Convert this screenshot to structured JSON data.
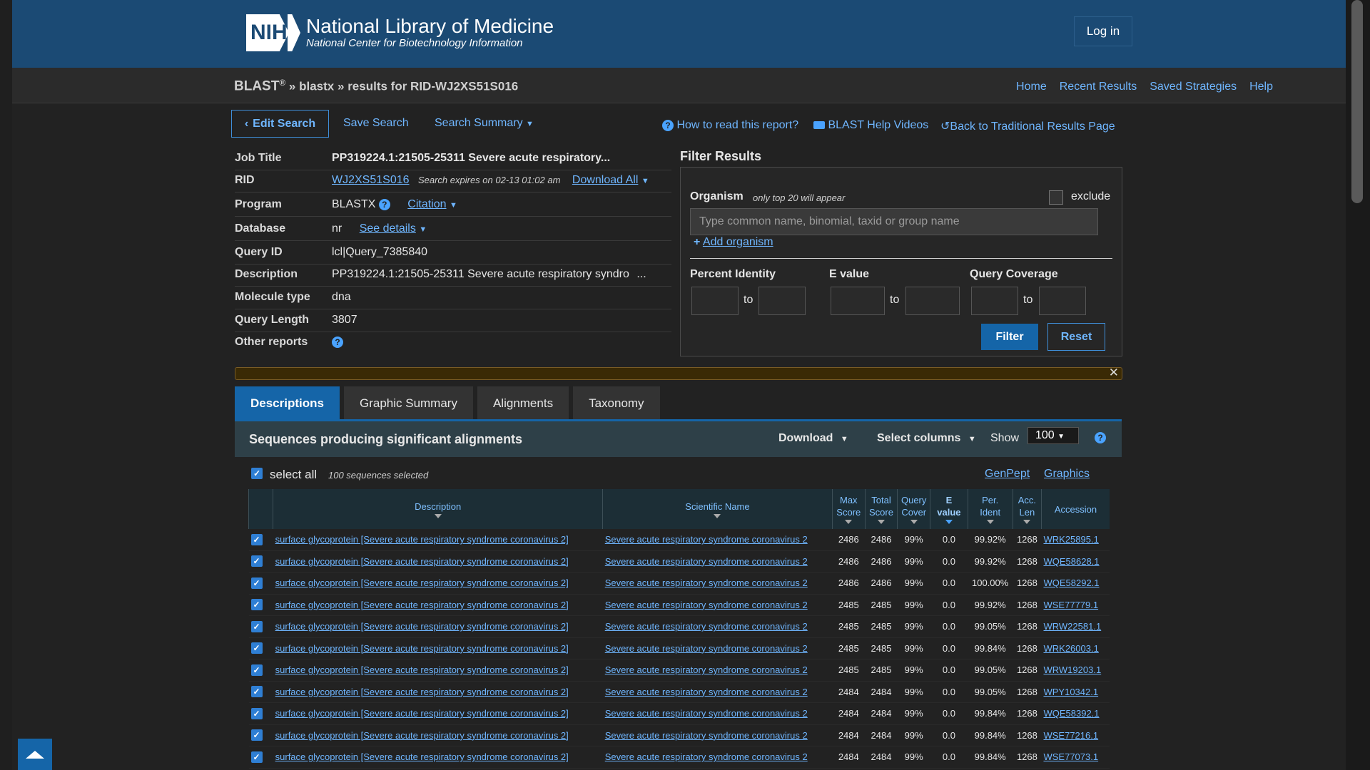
{
  "header": {
    "logo_short": "NIH",
    "org_name": "National Library of Medicine",
    "org_sub": "National Center for Biotechnology Information",
    "login_label": "Log in"
  },
  "breadcrumb": {
    "app": "BLAST",
    "reg": "®",
    "sep": "»",
    "program": "blastx",
    "results": "results for RID-WJ2XS51S016"
  },
  "subnav": [
    "Home",
    "Recent Results",
    "Saved Strategies",
    "Help"
  ],
  "toolbar": {
    "edit_search": "Edit Search",
    "save_search": "Save Search",
    "search_summary": "Search Summary",
    "how_to_read": "How to read this report?",
    "help_videos": "BLAST Help Videos",
    "back_traditional": "Back to Traditional Results Page"
  },
  "job": {
    "title_label": "Job Title",
    "title_value": "PP319224.1:21505-25311 Severe acute respiratory...",
    "rid_label": "RID",
    "rid_value": "WJ2XS51S016",
    "rid_expires": "Search expires on 02-13 01:02 am",
    "download_all": "Download All",
    "program_label": "Program",
    "program_value": "BLASTX",
    "citation": "Citation",
    "database_label": "Database",
    "database_value": "nr",
    "see_details": "See details",
    "query_id_label": "Query ID",
    "query_id_value": "lcl|Query_7385840",
    "description_label": "Description",
    "description_value": "PP319224.1:21505-25311 Severe acute respiratory syndro",
    "description_more": "...",
    "molecule_label": "Molecule type",
    "molecule_value": "dna",
    "query_length_label": "Query Length",
    "query_length_value": "3807",
    "other_reports_label": "Other reports"
  },
  "filter": {
    "title": "Filter Results",
    "organism_label": "Organism",
    "organism_note": "only top 20 will appear",
    "exclude_label": "exclude",
    "organism_placeholder": "Type common  name, binomial, taxid or group  name",
    "add_organism": "Add organism",
    "percent_identity": "Percent Identity",
    "e_value": "E value",
    "query_coverage": "Query Coverage",
    "to": "to",
    "filter_btn": "Filter",
    "reset_btn": "Reset"
  },
  "tabs": [
    "Descriptions",
    "Graphic Summary",
    "Alignments",
    "Taxonomy"
  ],
  "results": {
    "title": "Sequences producing significant alignments",
    "download": "Download",
    "select_columns": "Select columns",
    "show_label": "Show",
    "show_value": "100",
    "select_all": "select all",
    "selected_count": "100 sequences selected",
    "genpept": "GenPept",
    "graphics": "Graphics",
    "columns": {
      "description": "Description",
      "scientific_name": "Scientific Name",
      "max_score_1": "Max",
      "max_score_2": "Score",
      "total_score_1": "Total",
      "total_score_2": "Score",
      "query_cover_1": "Query",
      "query_cover_2": "Cover",
      "e_value_1": "E",
      "e_value_2": "value",
      "per_ident_1": "Per.",
      "per_ident_2": "Ident",
      "acc_len_1": "Acc.",
      "acc_len_2": "Len",
      "accession": "Accession"
    },
    "rows": [
      {
        "desc": "surface glycoprotein [Severe acute respiratory syndrome coronavirus 2]",
        "sci": "Severe acute respiratory syndrome coronavirus 2",
        "max": "2486",
        "total": "2486",
        "cover": "99%",
        "evalue": "0.0",
        "ident": "99.92%",
        "len": "1268",
        "acc": "WRK25895.1"
      },
      {
        "desc": "surface glycoprotein [Severe acute respiratory syndrome coronavirus 2]",
        "sci": "Severe acute respiratory syndrome coronavirus 2",
        "max": "2486",
        "total": "2486",
        "cover": "99%",
        "evalue": "0.0",
        "ident": "99.92%",
        "len": "1268",
        "acc": "WQE58628.1"
      },
      {
        "desc": "surface glycoprotein [Severe acute respiratory syndrome coronavirus 2]",
        "sci": "Severe acute respiratory syndrome coronavirus 2",
        "max": "2486",
        "total": "2486",
        "cover": "99%",
        "evalue": "0.0",
        "ident": "100.00%",
        "len": "1268",
        "acc": "WQE58292.1"
      },
      {
        "desc": "surface glycoprotein [Severe acute respiratory syndrome coronavirus 2]",
        "sci": "Severe acute respiratory syndrome coronavirus 2",
        "max": "2485",
        "total": "2485",
        "cover": "99%",
        "evalue": "0.0",
        "ident": "99.92%",
        "len": "1268",
        "acc": "WSE77779.1"
      },
      {
        "desc": "surface glycoprotein [Severe acute respiratory syndrome coronavirus 2]",
        "sci": "Severe acute respiratory syndrome coronavirus 2",
        "max": "2485",
        "total": "2485",
        "cover": "99%",
        "evalue": "0.0",
        "ident": "99.05%",
        "len": "1268",
        "acc": "WRW22581.1"
      },
      {
        "desc": "surface glycoprotein [Severe acute respiratory syndrome coronavirus 2]",
        "sci": "Severe acute respiratory syndrome coronavirus 2",
        "max": "2485",
        "total": "2485",
        "cover": "99%",
        "evalue": "0.0",
        "ident": "99.84%",
        "len": "1268",
        "acc": "WRK26003.1"
      },
      {
        "desc": "surface glycoprotein [Severe acute respiratory syndrome coronavirus 2]",
        "sci": "Severe acute respiratory syndrome coronavirus 2",
        "max": "2485",
        "total": "2485",
        "cover": "99%",
        "evalue": "0.0",
        "ident": "99.05%",
        "len": "1268",
        "acc": "WRW19203.1"
      },
      {
        "desc": "surface glycoprotein [Severe acute respiratory syndrome coronavirus 2]",
        "sci": "Severe acute respiratory syndrome coronavirus 2",
        "max": "2484",
        "total": "2484",
        "cover": "99%",
        "evalue": "0.0",
        "ident": "99.05%",
        "len": "1268",
        "acc": "WPY10342.1"
      },
      {
        "desc": "surface glycoprotein [Severe acute respiratory syndrome coronavirus 2]",
        "sci": "Severe acute respiratory syndrome coronavirus 2",
        "max": "2484",
        "total": "2484",
        "cover": "99%",
        "evalue": "0.0",
        "ident": "99.84%",
        "len": "1268",
        "acc": "WQE58392.1"
      },
      {
        "desc": "surface glycoprotein [Severe acute respiratory syndrome coronavirus 2]",
        "sci": "Severe acute respiratory syndrome coronavirus 2",
        "max": "2484",
        "total": "2484",
        "cover": "99%",
        "evalue": "0.0",
        "ident": "99.84%",
        "len": "1268",
        "acc": "WSE77216.1"
      },
      {
        "desc": "surface glycoprotein [Severe acute respiratory syndrome coronavirus 2]",
        "sci": "Severe acute respiratory syndrome coronavirus 2",
        "max": "2484",
        "total": "2484",
        "cover": "99%",
        "evalue": "0.0",
        "ident": "99.84%",
        "len": "1268",
        "acc": "WSE77073.1"
      }
    ]
  },
  "colors": {
    "header_bg": "#1b4a74",
    "accent_blue": "#1565a8",
    "link": "#6fb6ff",
    "page_bg": "#222222"
  }
}
